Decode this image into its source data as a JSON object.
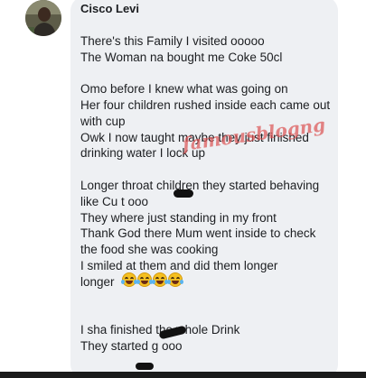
{
  "comment": {
    "author": "Cisco Levi",
    "body_top": "There's this Family I visited ooooo\nThe Woman na bought me Coke 50cl\n\nOmo before I knew what was going on\nHer four children rushed inside each came out with cup\nOwk I now taught maybe they just finished drinking water I lock up\n\nLonger throat children they started behaving like Cu     t ooo\nThey where just standing in my front\nThank God there Mum went inside to check the food she was cooking\nI smiled at them and did them longer\nlonger",
    "body_bottom": "I sha finished the whole Drink\nThey started         g ooo\n\nI really An     yed them",
    "emojis": [
      "face-with-tears-of-joy-icon",
      "face-with-tears-of-joy-icon",
      "face-with-tears-of-joy-icon",
      "face-with-tears-of-joy-icon"
    ]
  },
  "watermark": "famousblogng"
}
